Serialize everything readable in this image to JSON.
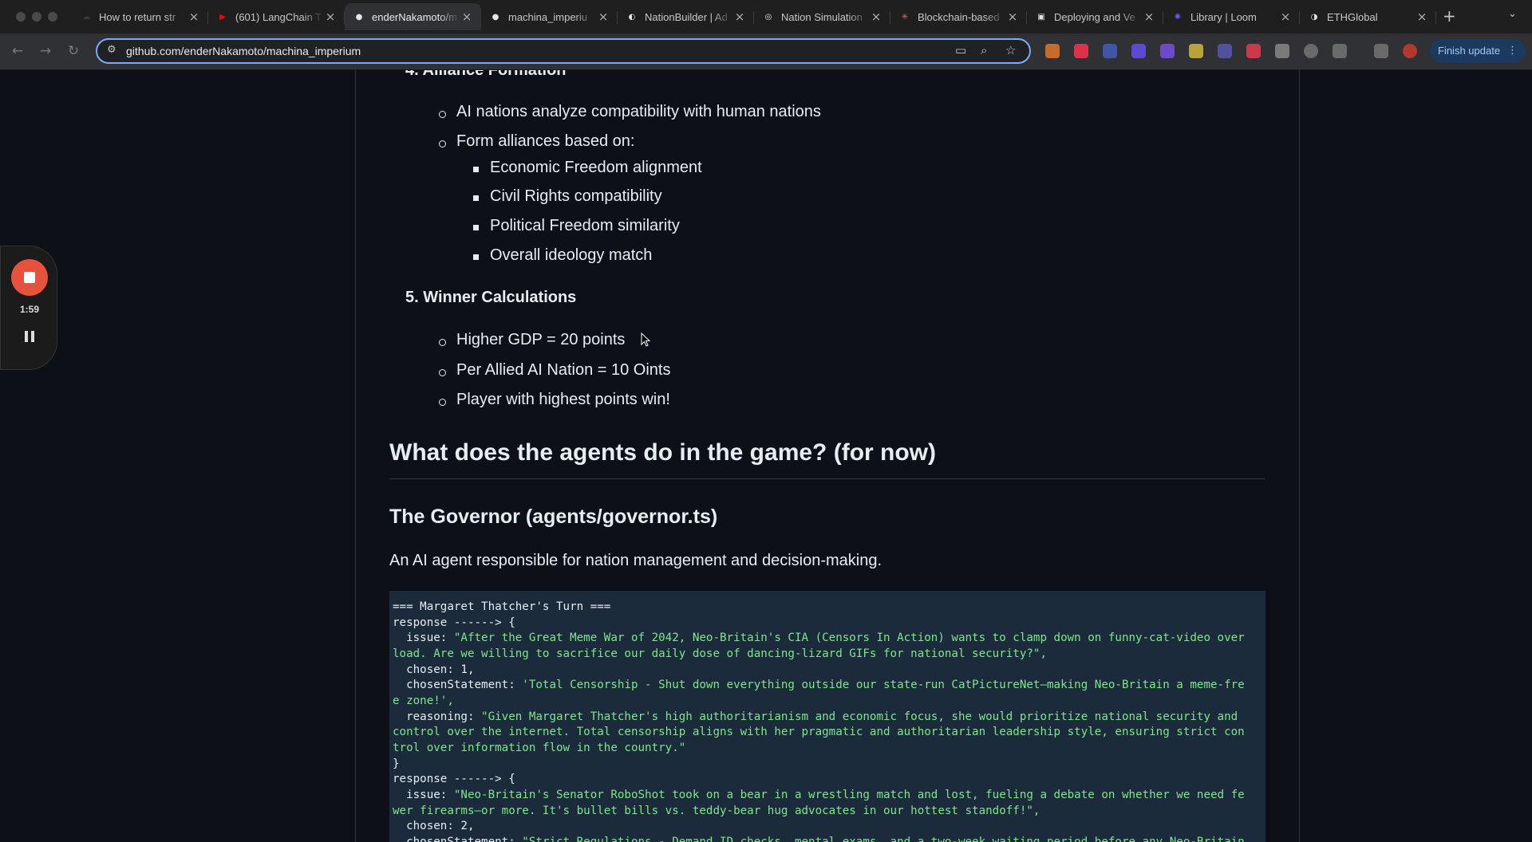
{
  "browser": {
    "tabs": [
      {
        "title": "How to return str",
        "favicon_color": "#3b3b3b",
        "favicon_glyph": "☁"
      },
      {
        "title": "(601) LangChain T",
        "favicon_color": "#ff0000",
        "favicon_glyph": "▶"
      },
      {
        "title": "enderNakamoto/m",
        "favicon_color": "#e6e6e6",
        "favicon_glyph": "●",
        "active": true
      },
      {
        "title": "machina_imperiu",
        "favicon_color": "#e6e6e6",
        "favicon_glyph": "●"
      },
      {
        "title": "NationBuilder | Ad",
        "favicon_color": "#e6e6e6",
        "favicon_glyph": "◐"
      },
      {
        "title": "Nation Simulation",
        "favicon_color": "#e6e6e6",
        "favicon_glyph": "◎"
      },
      {
        "title": "Blockchain-based",
        "favicon_color": "#d97757",
        "favicon_glyph": "✳"
      },
      {
        "title": "Deploying and Ve",
        "favicon_color": "#e6e6e6",
        "favicon_glyph": "▣"
      },
      {
        "title": "Library | Loom",
        "favicon_color": "#625df5",
        "favicon_glyph": "✺"
      },
      {
        "title": "ETHGlobal",
        "favicon_color": "#e6e6e6",
        "favicon_glyph": "◑"
      }
    ],
    "url": "github.com/enderNakamoto/machina_imperium",
    "finish_update": "Finish update",
    "icons": {
      "back": "back-arrow-icon",
      "forward": "forward-arrow-icon",
      "reload": "reload-icon",
      "new_tab": "plus-icon"
    }
  },
  "recorder": {
    "timer": "1:59"
  },
  "readme": {
    "section4": {
      "heading": "4. Alliance Formation",
      "items": [
        "AI nations analyze compatibility with human nations",
        "Form alliances based on:"
      ],
      "subitems": [
        "Economic Freedom alignment",
        "Civil Rights compatibility",
        "Political Freedom similarity",
        "Overall ideology match"
      ]
    },
    "section5": {
      "heading": "5. Winner Calculations",
      "items": [
        "Higher GDP = 20 points",
        "Per Allied AI Nation = 10 Oints",
        "Player with highest points win!"
      ]
    },
    "agents_heading": "What does the agents do in the game? (for now)",
    "governor_heading": "The Governor (agents/governor.ts)",
    "governor_desc": "An AI agent responsible for nation management and decision-making.",
    "code": {
      "l1": "=== Margaret Thatcher's Turn ===",
      "l2": "response ------> {",
      "l3a": "  issue: ",
      "l3b": "\"After the Great Meme War of 2042, Neo-Britain's CIA (Censors In Action) wants to clamp down on funny-cat-video over",
      "l4": "load. Are we willing to sacrifice our daily dose of dancing-lizard GIFs for national security?\",",
      "l5": "  chosen: 1,",
      "l6a": "  chosenStatement: ",
      "l6b": "'Total Censorship - Shut down everything outside our state-run CatPictureNet—making Neo-Britain a meme-fre",
      "l7": "e zone!',",
      "l8a": "  reasoning: ",
      "l8b": "\"Given Margaret Thatcher's high authoritarianism and economic focus, she would prioritize national security and",
      "l9": "control over the internet. Total censorship aligns with her pragmatic and authoritarian leadership style, ensuring strict con",
      "l10": "trol over information flow in the country.\"",
      "l11": "}",
      "l12": "response ------> {",
      "l13a": "  issue: ",
      "l13b": "\"Neo-Britain's Senator RoboShot took on a bear in a wrestling match and lost, fueling a debate on whether we need fe",
      "l14": "wer firearms—or more. It's bullet bills vs. teddy-bear hug advocates in our hottest standoff!\",",
      "l15": "  chosen: 2,",
      "l16a": "  chosenStatement: ",
      "l16b": "\"Strict Regulations - Demand ID checks, mental exams, and a two-week waiting period before any Neo-Britain"
    }
  }
}
